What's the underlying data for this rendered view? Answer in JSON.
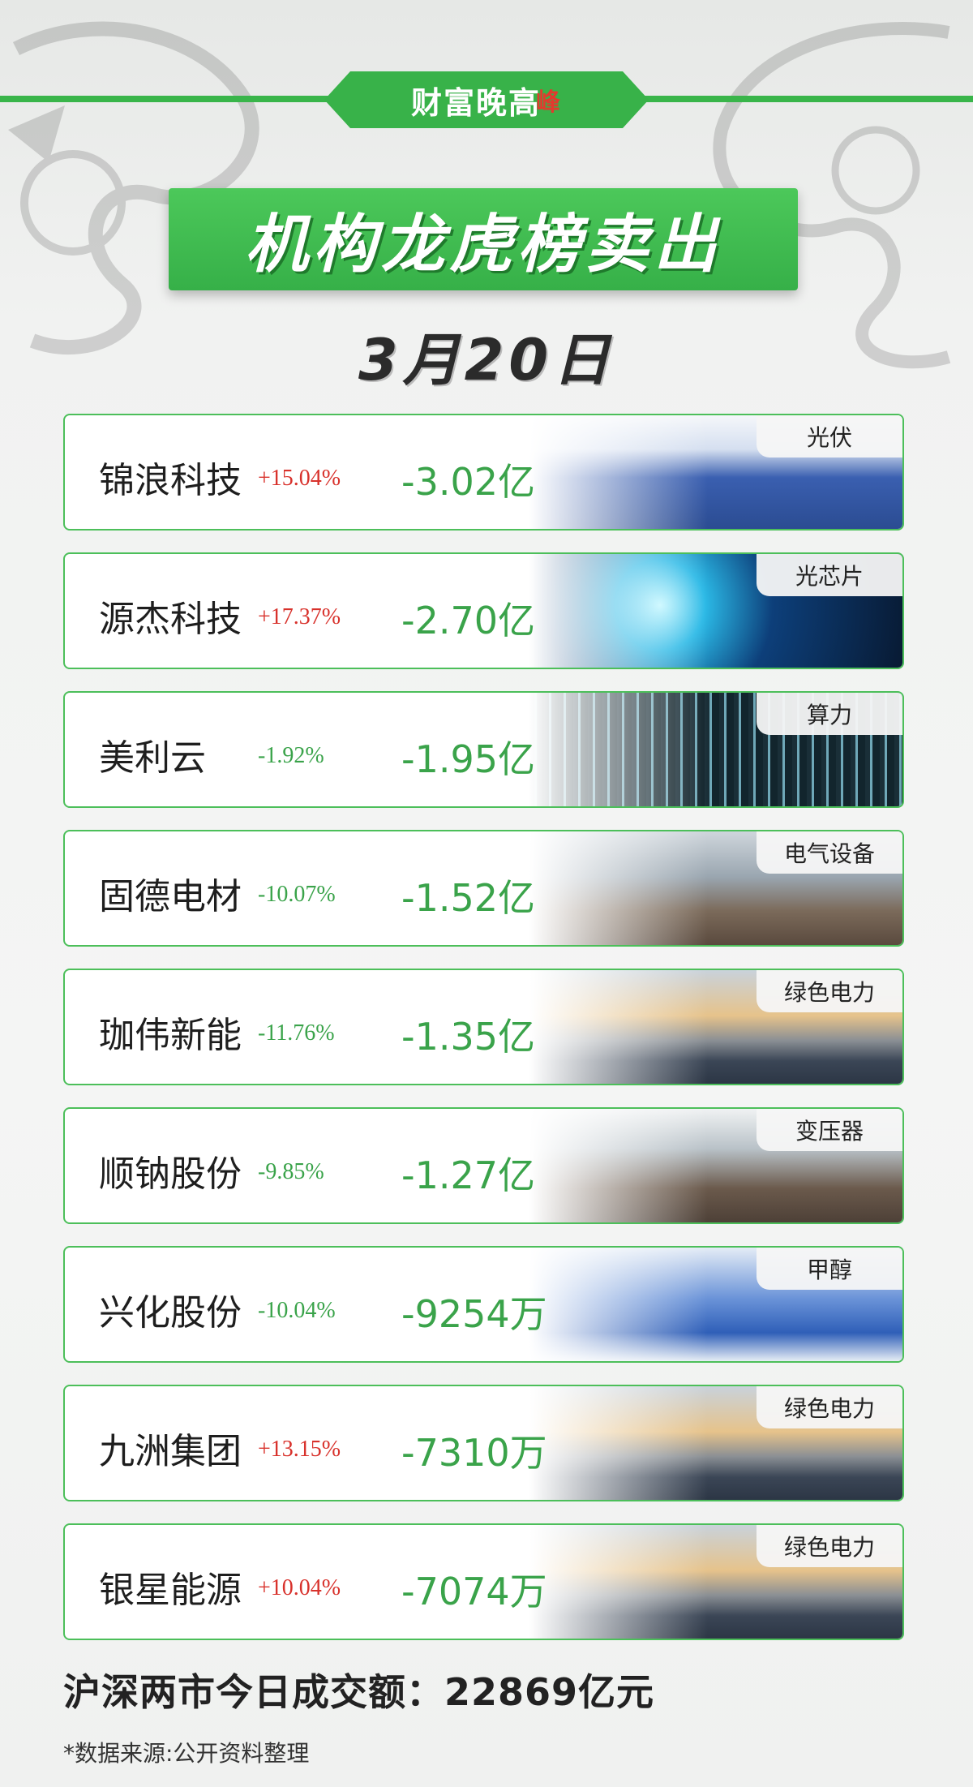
{
  "brand": {
    "name": "财富晚高",
    "mark": "峰"
  },
  "title": "机构龙虎榜卖出",
  "date": "3月20日",
  "rows": [
    {
      "name": "锦浪科技",
      "pct": "+15.04%",
      "direction": "up",
      "amount": "-3.02亿",
      "tag": "光伏",
      "image": "solar-panels"
    },
    {
      "name": "源杰科技",
      "pct": "+17.37%",
      "direction": "up",
      "amount": "-2.70亿",
      "tag": "光芯片",
      "image": "chip"
    },
    {
      "name": "美利云",
      "pct": "-1.92%",
      "direction": "down",
      "amount": "-1.95亿",
      "tag": "算力",
      "image": "data-stream"
    },
    {
      "name": "固德电材",
      "pct": "-10.07%",
      "direction": "down",
      "amount": "-1.52亿",
      "tag": "电气设备",
      "image": "factory"
    },
    {
      "name": "珈伟新能",
      "pct": "-11.76%",
      "direction": "down",
      "amount": "-1.35亿",
      "tag": "绿色电力",
      "image": "wind-solar"
    },
    {
      "name": "顺钠股份",
      "pct": "-9.85%",
      "direction": "down",
      "amount": "-1.27亿",
      "tag": "变压器",
      "image": "transformer"
    },
    {
      "name": "兴化股份",
      "pct": "-10.04%",
      "direction": "down",
      "amount": "-9254万",
      "tag": "甲醇",
      "image": "chemical-plant"
    },
    {
      "name": "九洲集团",
      "pct": "+13.15%",
      "direction": "up",
      "amount": "-7310万",
      "tag": "绿色电力",
      "image": "wind-solar"
    },
    {
      "name": "银星能源",
      "pct": "+10.04%",
      "direction": "up",
      "amount": "-7074万",
      "tag": "绿色电力",
      "image": "wind-solar"
    }
  ],
  "total": "沪深两市今日成交额：22869亿元",
  "source": "*数据来源:公开资料整理",
  "colors": {
    "green": "#39b54a",
    "up": "#d8322c",
    "down": "#3aa34a"
  }
}
